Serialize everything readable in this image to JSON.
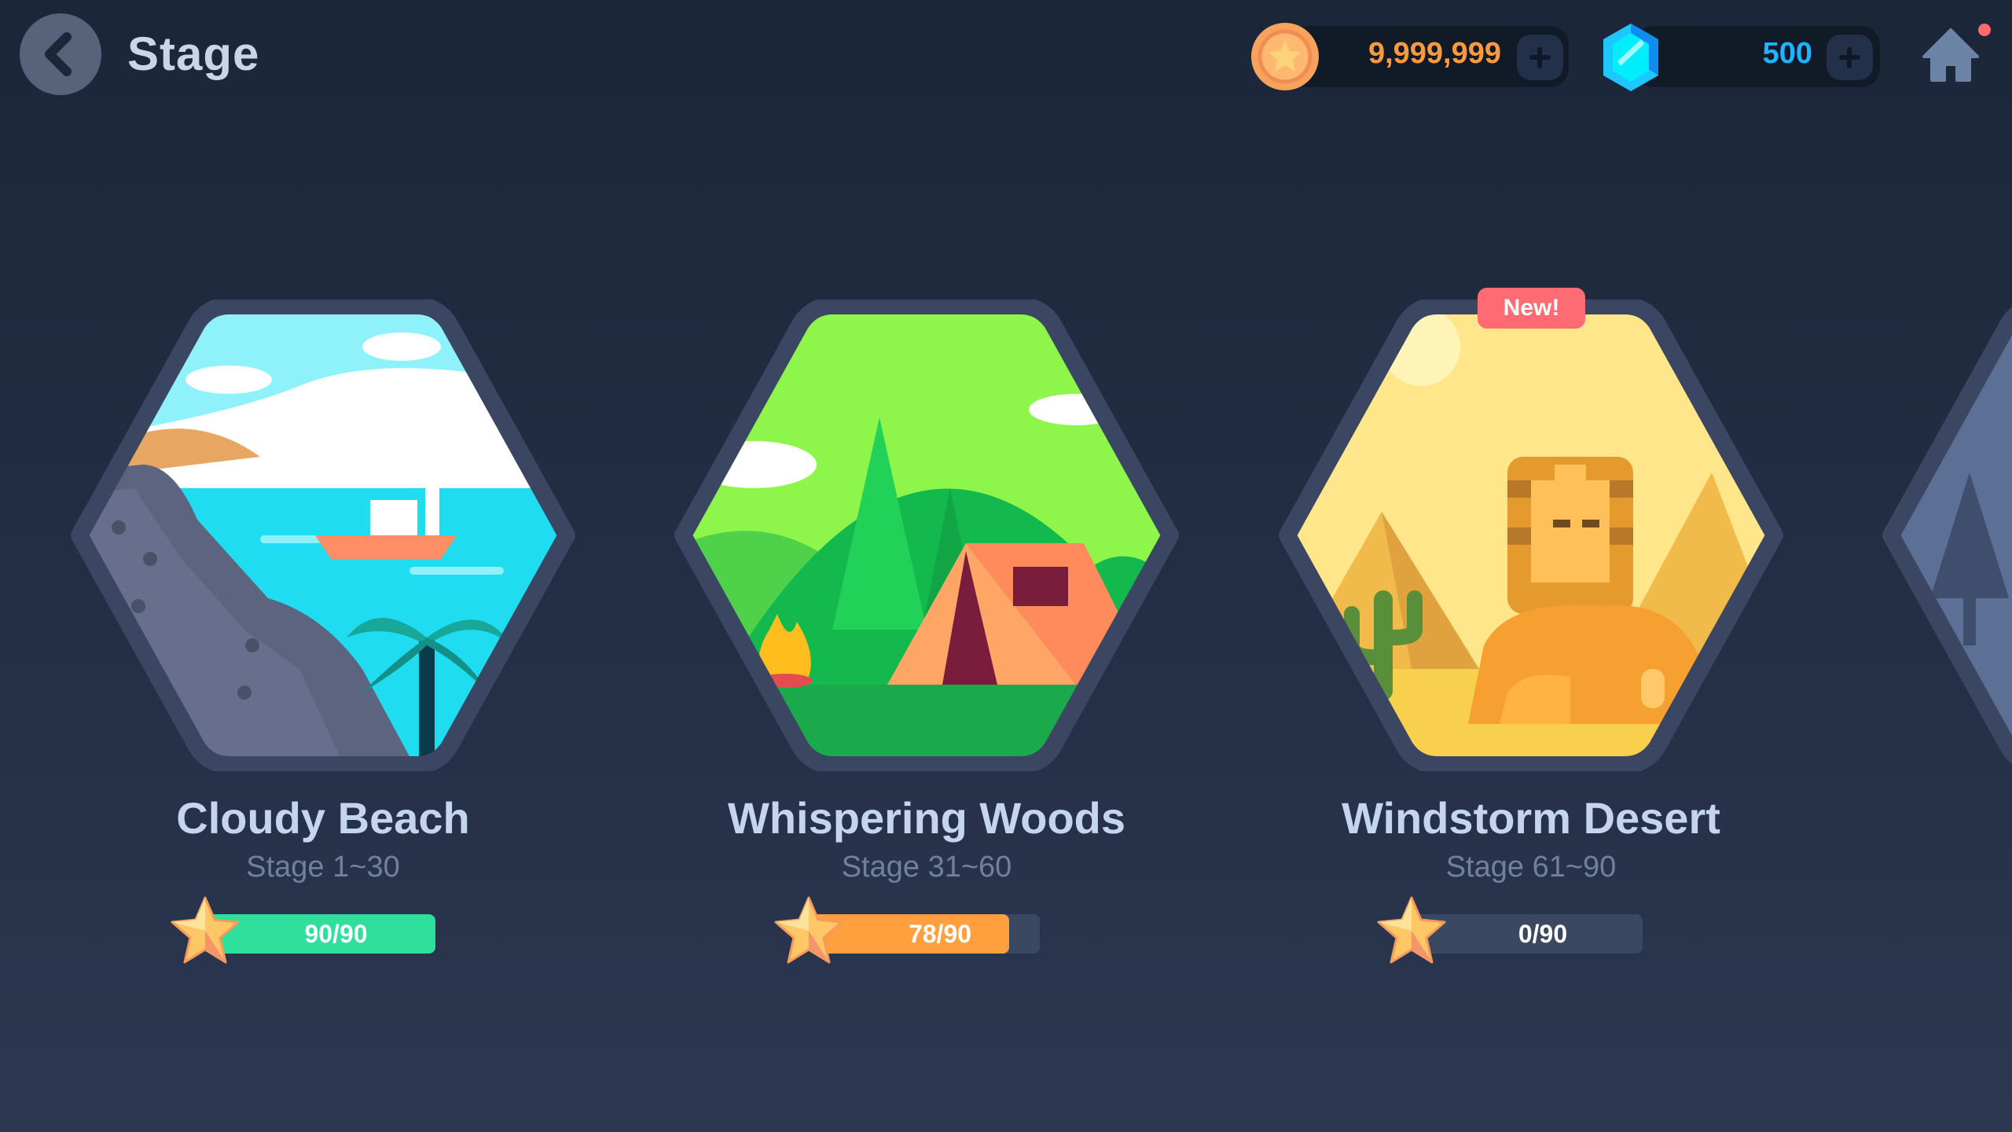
{
  "header": {
    "title": "Stage",
    "back_icon": "chevron-left-icon",
    "home_icon": "home-icon"
  },
  "currency": {
    "coins": {
      "value": "9,999,999",
      "icon": "coin-icon",
      "color": "#ff9a3c"
    },
    "gems": {
      "value": "500",
      "icon": "gem-icon",
      "color": "#1eb4ff"
    }
  },
  "stages": [
    {
      "name": "Cloudy Beach",
      "range": "Stage 1~30",
      "stars": "90/90",
      "progress": 1.0,
      "color": "#2ee09b"
    },
    {
      "name": "Whispering Woods",
      "range": "Stage 31~60",
      "stars": "78/90",
      "progress": 0.867,
      "color": "#ff9f3d"
    },
    {
      "name": "Windstorm Desert",
      "range": "Stage 61~90",
      "stars": "0/90",
      "progress": 0.0,
      "color": "#3a4862",
      "badge": "New!"
    }
  ]
}
